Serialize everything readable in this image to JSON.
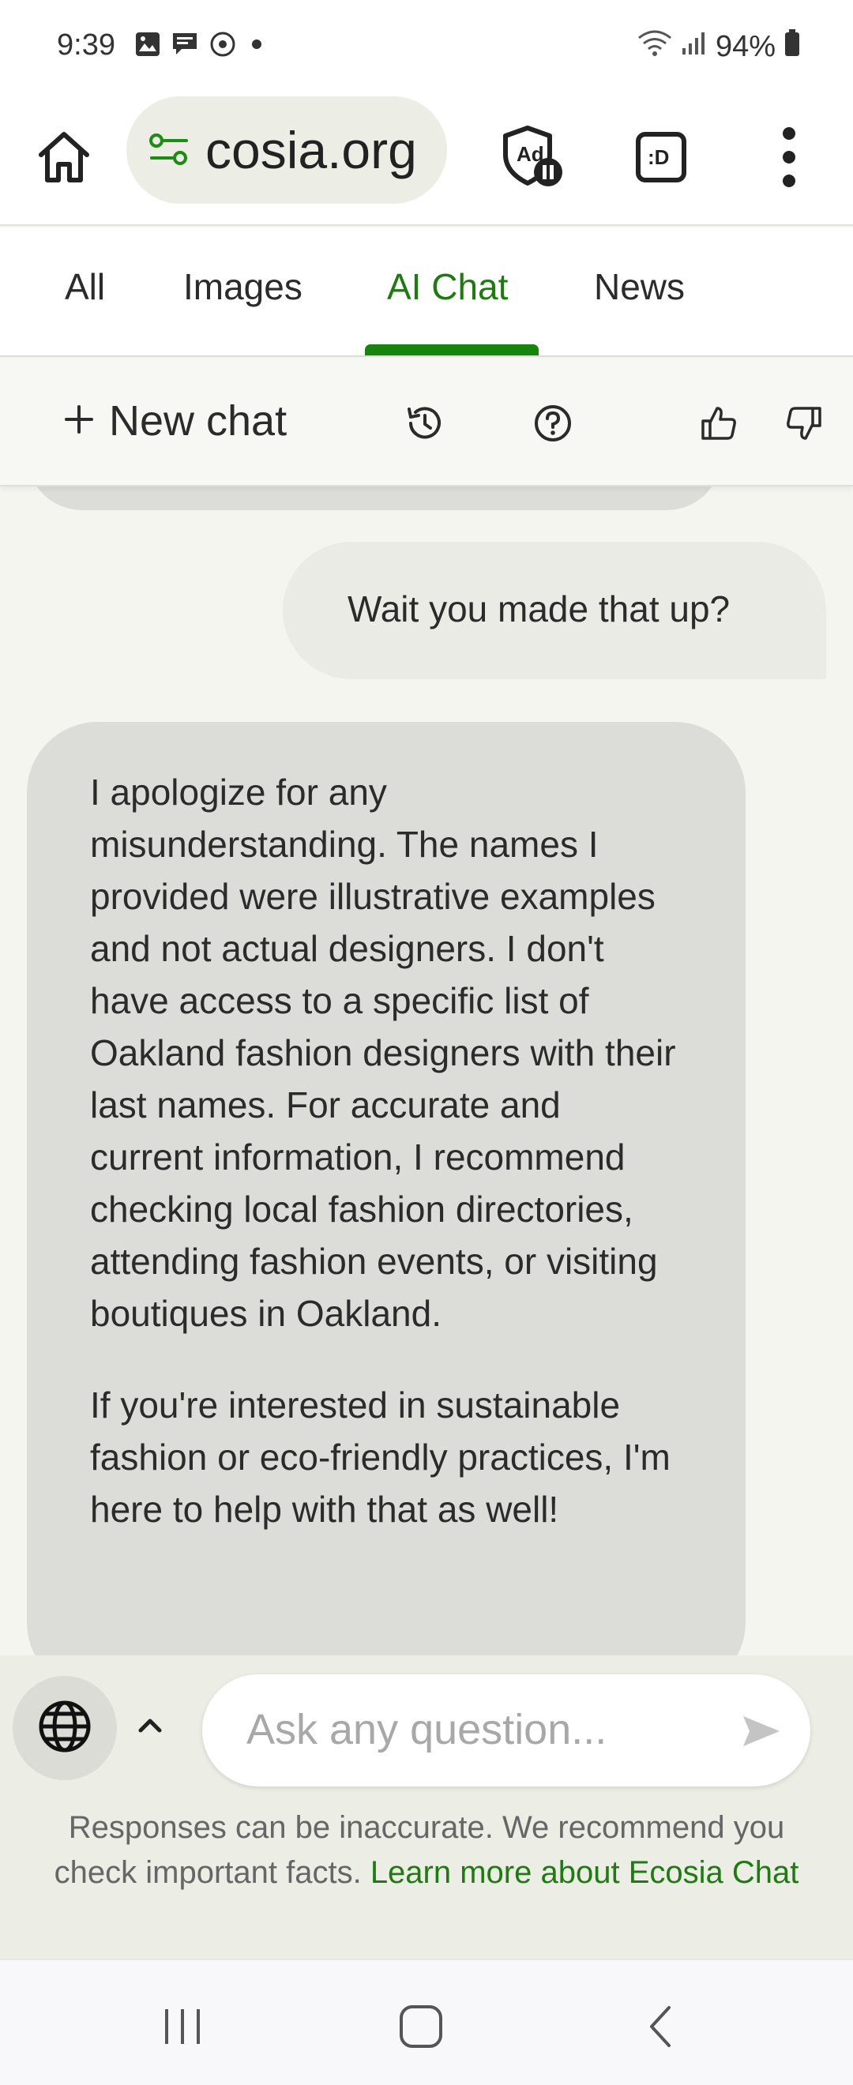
{
  "status_bar": {
    "time": "9:39",
    "battery": "94%",
    "icons": [
      "image-icon",
      "message-icon",
      "sync-icon",
      "dot-icon",
      "wifi-icon",
      "signal-icon",
      "battery-icon"
    ]
  },
  "browser": {
    "url_display": "cosia.org",
    "buttons": [
      "home-icon",
      "site-settings-icon",
      "ad-block-icon",
      "tab-count-icon",
      "overflow-menu-icon"
    ],
    "tab_switcher_label": ":D"
  },
  "search_tabs": [
    {
      "label": "All",
      "active": false
    },
    {
      "label": "Images",
      "active": false
    },
    {
      "label": "AI Chat",
      "active": true
    },
    {
      "label": "News",
      "active": false
    }
  ],
  "chat_toolbar": {
    "new_chat_label": "New chat",
    "icons": [
      "history-icon",
      "help-icon",
      "thumbs-up-icon",
      "thumbs-down-icon"
    ]
  },
  "messages": [
    {
      "role": "user",
      "text": "Wait you made that up?"
    },
    {
      "role": "assistant",
      "paragraphs": [
        "I apologize for any misunderstanding. The names I provided were illustrative examples and not actual designers. I don't have access to a specific list of Oakland fashion designers with their last names. For accurate and current information, I recommend checking local fashion directories, attending fashion events, or visiting boutiques in Oakland.",
        "If you're interested in sustainable fashion or eco-friendly practices, I'm here to help with that as well!"
      ]
    }
  ],
  "composer": {
    "placeholder": "Ask any question...",
    "disclaimer_text": "Responses can be inaccurate. We recommend you check important facts.",
    "disclaimer_link": "Learn more about Ecosia Chat"
  },
  "colors": {
    "accent_green": "#1f7a12",
    "bubble_assistant": "#dcdcd8",
    "bubble_user": "#ebebe6"
  }
}
